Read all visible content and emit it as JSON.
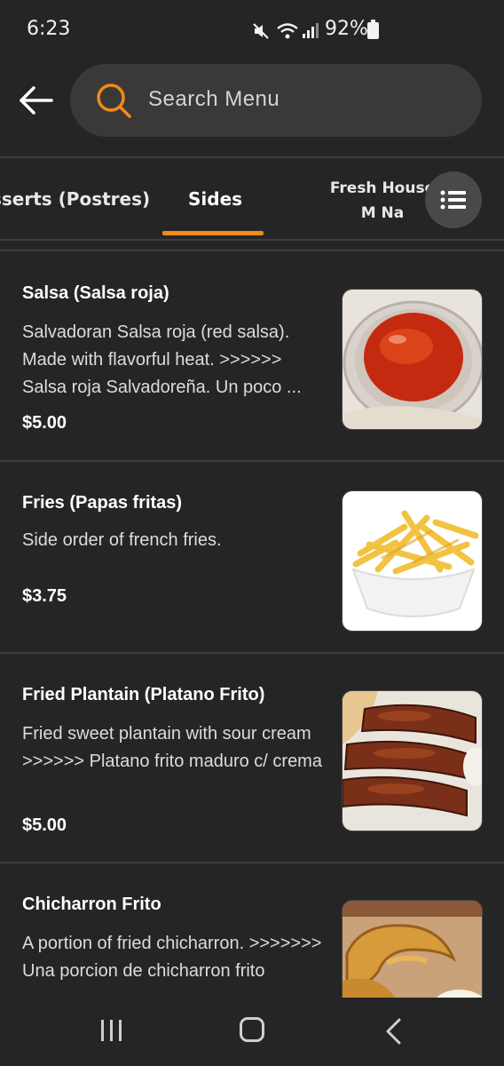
{
  "status_bar": {
    "time": "6:23",
    "battery": "92%",
    "icons": [
      "mute-icon",
      "wifi-icon",
      "signal-icon",
      "battery-icon"
    ]
  },
  "search": {
    "placeholder": "Search Menu"
  },
  "tabs": [
    {
      "label": "sserts (Postres)"
    },
    {
      "label": "Sides",
      "selected": true
    },
    {
      "label": "Fresh House M Na"
    }
  ],
  "colors": {
    "accent": "#f08a1c",
    "background": "#252525",
    "search_bg": "#3a3938"
  },
  "menu_items": [
    {
      "name": "Salsa (Salsa roja)",
      "description": "Salvadoran Salsa roja (red salsa). Made with flavorful heat. >>>>>> Salsa roja Salvadoreña. Un poco ...",
      "price": "$5.00"
    },
    {
      "name": "Fries (Papas fritas)",
      "description": "Side order of french fries.",
      "price": "$3.75"
    },
    {
      "name": "Fried Plantain (Platano Frito)",
      "description": "Fried sweet plantain with sour cream >>>>>> Platano frito maduro c/ crema",
      "price": "$5.00"
    },
    {
      "name": "Chicharron Frito",
      "description": "A portion of fried chicharron. >>>>>>> Una porcion de chicharron frito",
      "price": ""
    }
  ]
}
